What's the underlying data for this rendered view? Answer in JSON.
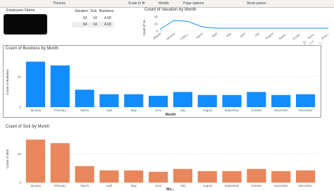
{
  "ribbon": {
    "themes": "Themes",
    "scale_to_fit": "Scale to fit",
    "mobile": "Mobile",
    "page_options": "Page options",
    "show_panes": "Show panes"
  },
  "employee_table": {
    "header": "Employee Name",
    "columns": [
      "Vacation",
      "Sick",
      "Business"
    ],
    "rows": [
      {
        "vacation": "63",
        "sick": "14",
        "business": "4.00"
      },
      {
        "vacation": "64",
        "sick": "14",
        "business": "4.00"
      }
    ]
  },
  "vacation_chart": {
    "title": "Count of Vacation by Month",
    "ylabel": "Count of Va..."
  },
  "business_chart": {
    "title": "Count of Business by Month",
    "ylabel": "Count of Business",
    "xlabel": "Month"
  },
  "sick_chart": {
    "title": "Count of Sick by Month",
    "ylabel": "Count of Sick",
    "xlabel": "Mo..."
  },
  "colors": {
    "business_bar": "#118dff",
    "sick_bar": "#e8875b",
    "vacation_line": "#118dff"
  },
  "chart_data": [
    {
      "type": "line",
      "title": "Count of Vacation by Month",
      "ylabel": "Count of Va...",
      "categories": [
        "(Blank)",
        "January",
        "Febru...",
        "March",
        "April",
        "May",
        "June",
        "July",
        "August",
        "Septe...",
        "Octob...",
        "Nove...",
        "Dece..."
      ],
      "values": [
        5,
        30,
        27,
        12,
        8,
        8,
        8,
        8,
        8,
        8,
        8,
        8,
        8
      ],
      "yticks": [
        0,
        20,
        40
      ],
      "ylim": [
        0,
        40
      ]
    },
    {
      "type": "bar",
      "title": "Count of Business by Month",
      "xlabel": "Month",
      "ylabel": "Count of Business",
      "categories": [
        "January",
        "February",
        "March",
        "April",
        "May",
        "June",
        "July",
        "August",
        "September",
        "October",
        "November",
        "December"
      ],
      "values": [
        30,
        27.5,
        11.5,
        8.5,
        8.5,
        7.5,
        10,
        8,
        8,
        10,
        8,
        8.5
      ],
      "yticks": [
        0,
        20
      ],
      "ylim": [
        0,
        33
      ]
    },
    {
      "type": "bar",
      "title": "Count of Sick by Month",
      "xlabel": "Mo...",
      "ylabel": "Count of Sick",
      "categories": [
        "January",
        "February",
        "March",
        "April",
        "May",
        "June",
        "July",
        "August",
        "September",
        "October",
        "November",
        "December"
      ],
      "values": [
        30,
        27.5,
        11.5,
        8.5,
        8.5,
        7.5,
        9.5,
        8,
        8,
        9.5,
        8,
        8.5
      ],
      "yticks": [
        0,
        20
      ],
      "ylim": [
        0,
        33
      ]
    }
  ]
}
